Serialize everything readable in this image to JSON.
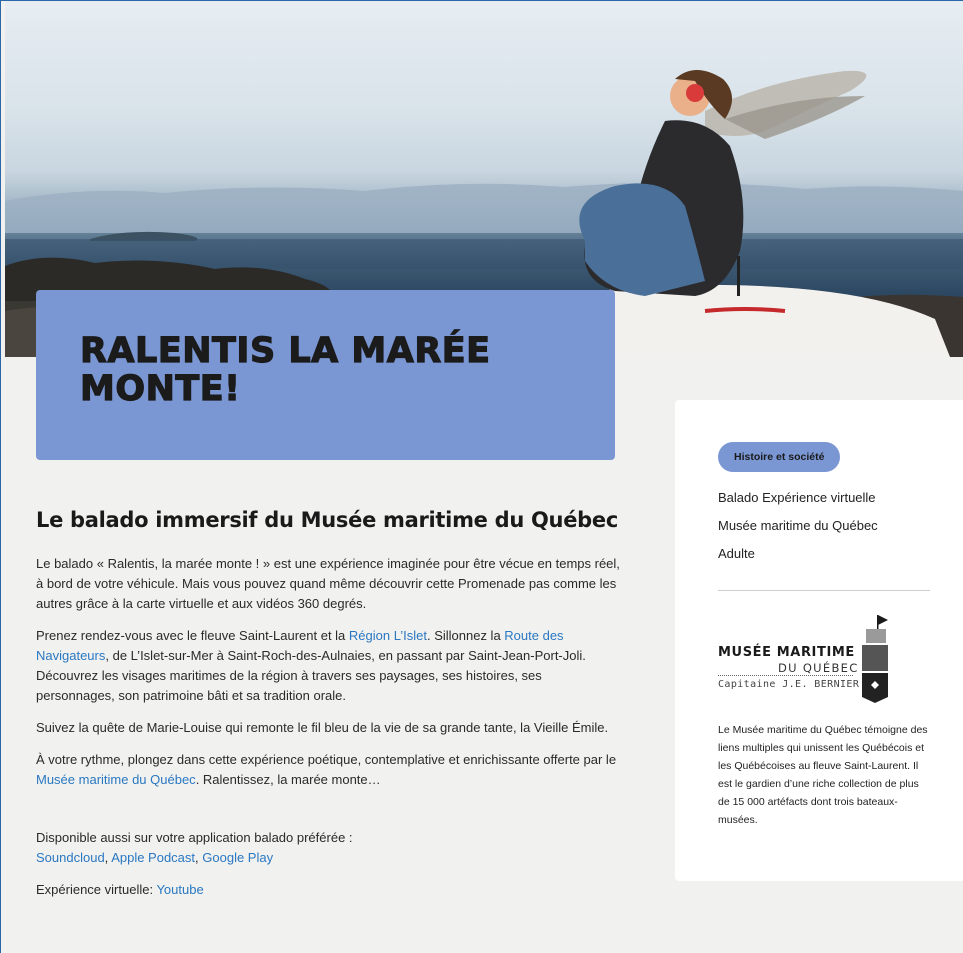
{
  "hero": {
    "image": "woman-sitting-on-car-by-river-photo"
  },
  "title": "RALENTIS LA MARÉE MONTE!",
  "main": {
    "heading": "Le balado immersif du Musée maritime du Québec",
    "p1": "Le balado « Ralentis, la marée monte ! » est une expérience imaginée pour être vécue en temps réel, à bord de votre véhicule. Mais vous pouvez quand même découvrir cette Promenade pas comme les autres grâce à la carte virtuelle et aux vidéos 360 degrés.",
    "p2_a": "Prenez rendez-vous avec le fleuve Saint-Laurent et la ",
    "p2_link1": "Région L’Islet",
    "p2_b": ". Sillonnez la ",
    "p2_link2": "Route des Navigateurs",
    "p2_c": ", de L’Islet-sur-Mer à Saint-Roch-des-Aulnaies, en passant par Saint-Jean-Port-Joli. Découvrez les visages maritimes de la région à travers ses paysages, ses histoires, ses personnages, son patrimoine bâti et sa tradition orale.",
    "p3": "Suivez la quête de Marie-Louise qui remonte le fil bleu de la vie de sa grande tante, la Vieille Émile.",
    "p4_a": "À votre rythme, plongez dans cette expérience poétique, contemplative et enrichissante offerte par le ",
    "p4_link": "Musée maritime du Québec",
    "p4_b": ". Ralentissez, la marée monte…",
    "avail_label": "Disponible aussi sur votre application balado préférée :",
    "link_soundcloud": "Soundcloud",
    "link_apple": "Apple Podcast",
    "link_google": "Google Play",
    "sep": ", ",
    "virtual_label": "Expérience virtuelle: ",
    "link_youtube": "Youtube"
  },
  "side": {
    "badge": "Histoire et société",
    "line1": "Balado Expérience virtuelle",
    "line2": "Musée maritime du Québec",
    "line3": "Adulte",
    "logo_line1": "MUSÉE MARITIME",
    "logo_line2": "DU QUÉBEC",
    "logo_line3": "Capitaine J.E. BERNIER",
    "description": "Le Musée maritime du Québec témoigne des liens multiples qui unissent les Québécois et les Québécoises au fleuve Saint-Laurent. Il est le gardien d’une riche collection de plus de 15 000 artéfacts dont trois bateaux-musées."
  },
  "colors": {
    "accent": "#7a97d4",
    "link": "#2a78c2",
    "background": "#f1f1ef"
  }
}
